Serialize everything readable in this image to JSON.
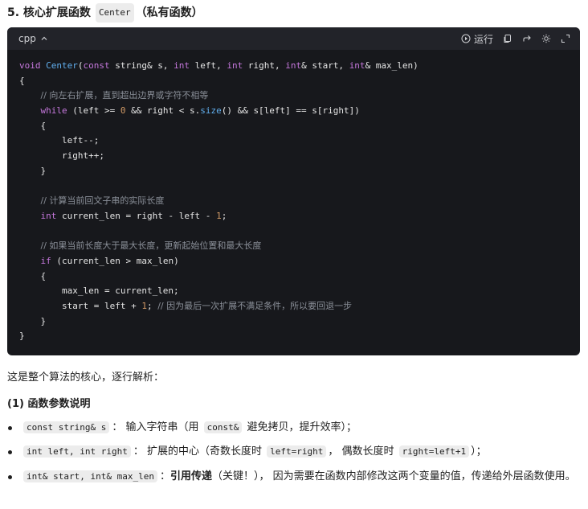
{
  "heading": {
    "prefix": "5. 核心扩展函数",
    "code": "Center",
    "suffix": "（私有函数）"
  },
  "code_block": {
    "language": "cpp",
    "run_label": "运行",
    "icons": [
      "chevron-up-icon",
      "play-circle-icon",
      "copy-icon",
      "share-icon",
      "theme-icon",
      "expand-icon"
    ],
    "lines": [
      [
        [
          "kw",
          "void"
        ],
        [
          "p",
          " "
        ],
        [
          "fn",
          "Center"
        ],
        [
          "p",
          "("
        ],
        [
          "kw",
          "const"
        ],
        [
          "p",
          " string& s, "
        ],
        [
          "kw",
          "int"
        ],
        [
          "p",
          " left, "
        ],
        [
          "kw",
          "int"
        ],
        [
          "p",
          " right, "
        ],
        [
          "kw",
          "int"
        ],
        [
          "p",
          "& start, "
        ],
        [
          "kw",
          "int"
        ],
        [
          "p",
          "& max_len)"
        ]
      ],
      [
        [
          "p",
          "{"
        ]
      ],
      [
        [
          "p",
          "    "
        ],
        [
          "cm",
          "// 向左右扩展，直到超出边界或字符不相等"
        ]
      ],
      [
        [
          "p",
          "    "
        ],
        [
          "kw",
          "while"
        ],
        [
          "p",
          " (left >= "
        ],
        [
          "num",
          "0"
        ],
        [
          "p",
          " && right < s."
        ],
        [
          "fn",
          "size"
        ],
        [
          "p",
          "() && s[left] == s[right])"
        ]
      ],
      [
        [
          "p",
          "    {"
        ]
      ],
      [
        [
          "p",
          "        left--;"
        ]
      ],
      [
        [
          "p",
          "        right++;"
        ]
      ],
      [
        [
          "p",
          "    }"
        ]
      ],
      [
        [
          "p",
          ""
        ]
      ],
      [
        [
          "p",
          "    "
        ],
        [
          "cm",
          "// 计算当前回文子串的实际长度"
        ]
      ],
      [
        [
          "p",
          "    "
        ],
        [
          "kw",
          "int"
        ],
        [
          "p",
          " current_len = right - left - "
        ],
        [
          "num",
          "1"
        ],
        [
          "p",
          ";"
        ]
      ],
      [
        [
          "p",
          ""
        ]
      ],
      [
        [
          "p",
          "    "
        ],
        [
          "cm",
          "// 如果当前长度大于最大长度，更新起始位置和最大长度"
        ]
      ],
      [
        [
          "p",
          "    "
        ],
        [
          "kw",
          "if"
        ],
        [
          "p",
          " (current_len > max_len)"
        ]
      ],
      [
        [
          "p",
          "    {"
        ]
      ],
      [
        [
          "p",
          "        max_len = current_len;"
        ]
      ],
      [
        [
          "p",
          "        start = left + "
        ],
        [
          "num",
          "1"
        ],
        [
          "p",
          "; "
        ],
        [
          "cm",
          "// 因为最后一次扩展不满足条件，所以要回退一步"
        ]
      ],
      [
        [
          "p",
          "    }"
        ]
      ],
      [
        [
          "p",
          "}"
        ]
      ]
    ]
  },
  "explanation": "这是整个算法的核心，逐行解析：",
  "subheading": "(1) 函数参数说明",
  "bullets": [
    {
      "code": "const string& s",
      "text1": "： 输入字符串（用 ",
      "code2": "const&",
      "text2": " 避免拷贝，提升效率）；"
    },
    {
      "code": "int left, int right",
      "text1": "： 扩展的中心（奇数长度时 ",
      "code2": "left=right",
      "text2": "， 偶数长度时 ",
      "code3": "right=left+1",
      "text3": "）；"
    },
    {
      "code": "int& start, int& max_len",
      "text1": "：",
      "bold": "引用传递",
      "text2": "（关键！）， 因为需要在函数内部修改这两个变量的值，传递给外层函数使用。"
    }
  ],
  "colors": {
    "code_bg": "#17181c",
    "code_header_bg": "#222329",
    "keyword": "#c678dd",
    "function": "#61afef",
    "number": "#d19a66",
    "comment": "#8a8f98"
  }
}
